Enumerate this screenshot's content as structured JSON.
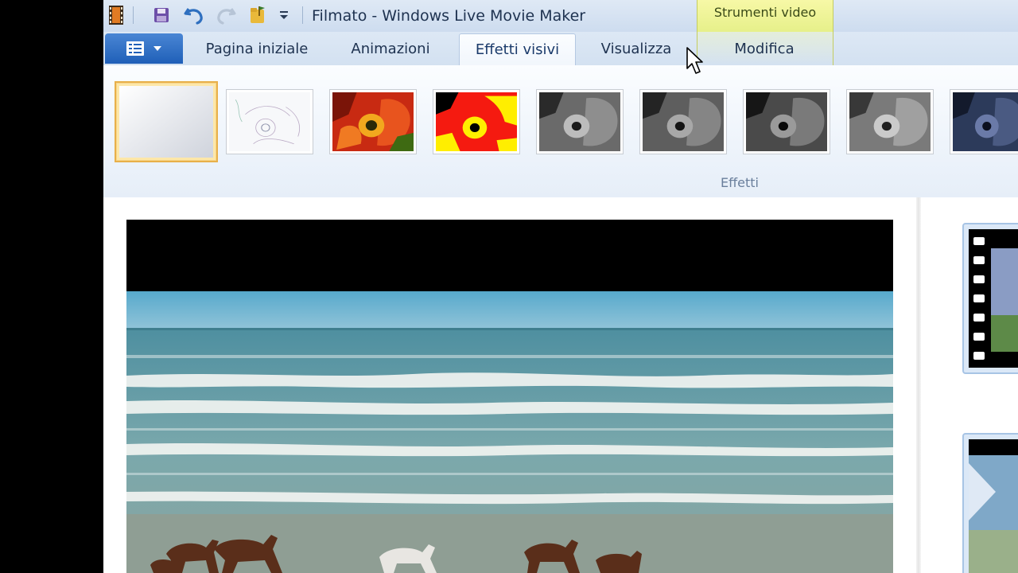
{
  "window": {
    "title": "Filmato - Windows Live Movie Maker"
  },
  "contextual_group": {
    "label": "Strumenti video"
  },
  "tabs": [
    {
      "label": "Pagina iniziale",
      "active": false
    },
    {
      "label": "Animazioni",
      "active": false
    },
    {
      "label": "Effetti visivi",
      "active": true
    },
    {
      "label": "Visualizza",
      "active": false
    },
    {
      "label": "Modifica",
      "active": false
    }
  ],
  "ribbon": {
    "group_label": "Effetti",
    "effects": [
      {
        "icon": "no-effect-thumbnail",
        "selected": true
      },
      {
        "icon": "edge-detection-thumbnail",
        "selected": false
      },
      {
        "icon": "posterize-thumbnail",
        "selected": false
      },
      {
        "icon": "threshold-thumbnail",
        "selected": false
      },
      {
        "icon": "grayscale-thumbnail",
        "selected": false
      },
      {
        "icon": "black-white-filter-thumbnail",
        "selected": false
      },
      {
        "icon": "black-white-contrast-thumbnail",
        "selected": false
      },
      {
        "icon": "sepia-gray-thumbnail",
        "selected": false
      },
      {
        "icon": "cyan-tone-thumbnail",
        "selected": false
      }
    ]
  },
  "colors": {
    "accent_blue": "#1f5fb8",
    "contextual_yellow": "#eef493",
    "selection_gold": "#e8b04a"
  }
}
